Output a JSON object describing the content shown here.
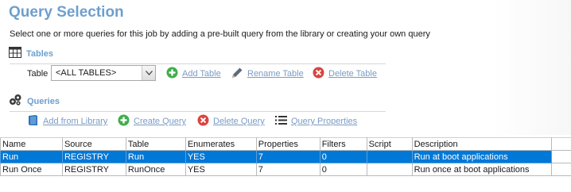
{
  "page": {
    "title": "Query Selection",
    "subtitle": "Select one or more queries for this job by adding a pre-built query from the library or creating your own query"
  },
  "tables_section": {
    "header": "Tables",
    "table_label": "Table",
    "selected_table": "<ALL TABLES>",
    "actions": {
      "add": "Add Table",
      "rename": "Rename Table",
      "delete": "Delete Table"
    }
  },
  "queries_section": {
    "header": "Queries",
    "actions": {
      "add_from_library": "Add from Library",
      "create": "Create Query",
      "delete": "Delete Query",
      "properties": "Query Properties"
    }
  },
  "grid": {
    "columns": [
      "Name",
      "Source",
      "Table",
      "Enumerates",
      "Properties",
      "Filters",
      "Script",
      "Description"
    ],
    "rows": [
      {
        "name": "Run",
        "source": "REGISTRY",
        "table": "Run",
        "enumerates": "YES",
        "properties": "7",
        "filters": "0",
        "script": "",
        "description": "Run at boot applications",
        "selected": true
      },
      {
        "name": "Run Once",
        "source": "REGISTRY",
        "table": "RunOnce",
        "enumerates": "YES",
        "properties": "7",
        "filters": "0",
        "script": "",
        "description": "Run once at boot applications",
        "selected": false
      }
    ]
  },
  "colors": {
    "title_blue": "#6e9fcd",
    "link_blue": "#7a9bc4",
    "selection_blue": "#0078d7",
    "add_green": "#3fae49",
    "delete_red": "#d9453f"
  },
  "icons": {
    "tables": "grid-table-icon",
    "queries": "gears-icon",
    "add": "green-plus-circle-icon",
    "rename": "pencil-icon",
    "delete": "red-x-circle-icon",
    "library": "book-icon",
    "properties": "list-icon",
    "dropdown": "chevron-down-icon"
  }
}
